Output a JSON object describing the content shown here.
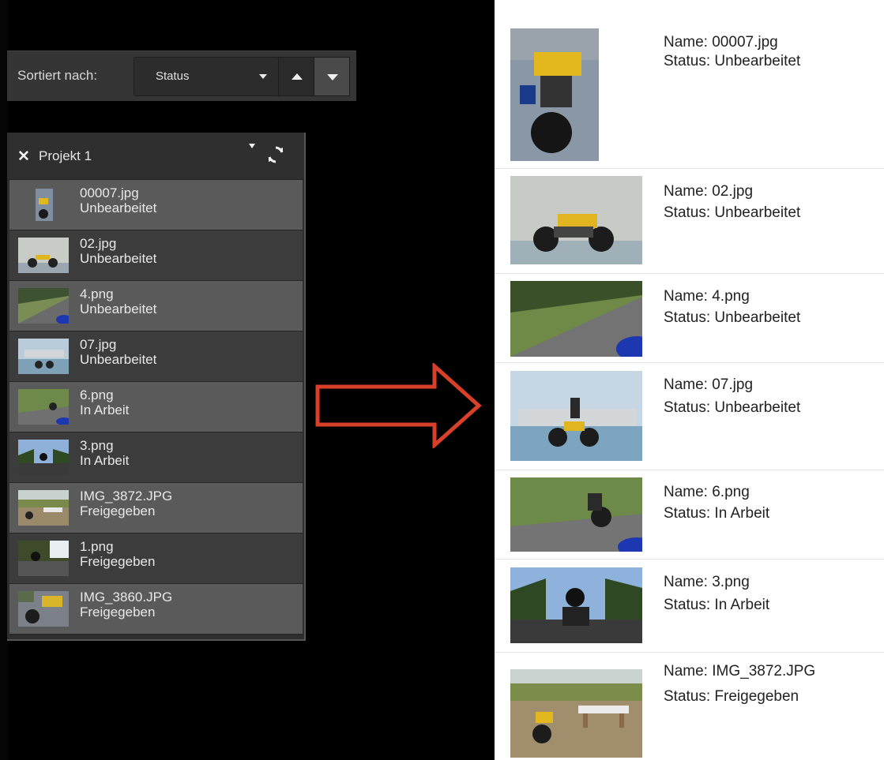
{
  "sort": {
    "label": "Sortiert nach:",
    "selected": "Status"
  },
  "project": {
    "title": "Projekt 1"
  },
  "files": [
    {
      "name": "00007.jpg",
      "status": "Unbearbeitet"
    },
    {
      "name": "02.jpg",
      "status": "Unbearbeitet"
    },
    {
      "name": "4.png",
      "status": "Unbearbeitet"
    },
    {
      "name": "07.jpg",
      "status": "Unbearbeitet"
    },
    {
      "name": "6.png",
      "status": "In Arbeit"
    },
    {
      "name": "3.png",
      "status": "In Arbeit"
    },
    {
      "name": "IMG_3872.JPG",
      "status": "Freigegeben"
    },
    {
      "name": "1.png",
      "status": "Freigegeben"
    },
    {
      "name": "IMG_3860.JPG",
      "status": "Freigegeben"
    }
  ],
  "cards": [
    {
      "name": "Name: 00007.jpg",
      "status": "Status: Unbearbeitet"
    },
    {
      "name": "Name: 02.jpg",
      "status": "Status: Unbearbeitet"
    },
    {
      "name": "Name: 4.png",
      "status": "Status: Unbearbeitet"
    },
    {
      "name": "Name: 07.jpg",
      "status": "Status: Unbearbeitet"
    },
    {
      "name": "Name: 6.png",
      "status": "Status: In Arbeit"
    },
    {
      "name": "Name: 3.png",
      "status": "Status: In Arbeit"
    },
    {
      "name": "Name: IMG_3872.JPG",
      "status": "Status: Freigegeben"
    }
  ],
  "colors": {
    "arrow": "#d9402a",
    "panel": "#2e2e2e",
    "row_light": "#5a5a5a",
    "row_dark": "#3c3c3c"
  }
}
